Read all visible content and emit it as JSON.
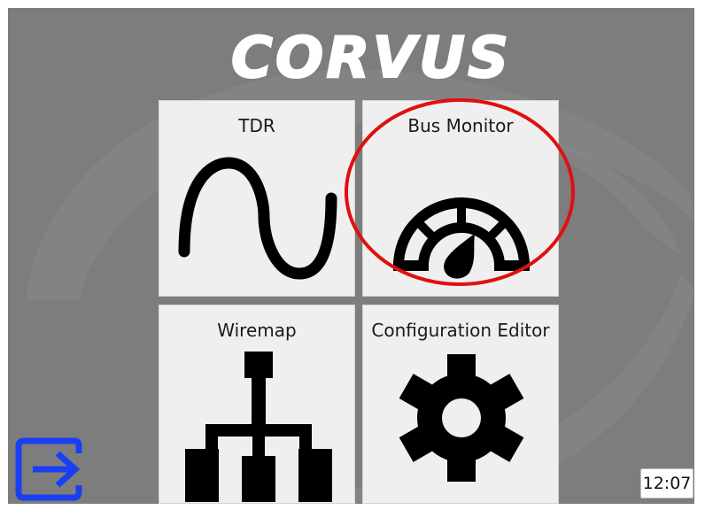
{
  "app": {
    "logo_text": "CORVUS"
  },
  "tiles": [
    {
      "id": "tdr",
      "label": "TDR",
      "icon": "sine-wave-icon"
    },
    {
      "id": "bus_monitor",
      "label": "Bus Monitor",
      "icon": "gauge-icon"
    },
    {
      "id": "wiremap",
      "label": "Wiremap",
      "icon": "network-hierarchy-icon"
    },
    {
      "id": "configuration_editor",
      "label": "Configuration Editor",
      "icon": "gear-icon"
    }
  ],
  "exit": {
    "icon": "exit-arrow-icon"
  },
  "status": {
    "time": "12:07"
  },
  "colors": {
    "background": "#7d7d7d",
    "tile": "#efefef",
    "exit_accent": "#1a3ff2",
    "highlight": "#e01010"
  }
}
